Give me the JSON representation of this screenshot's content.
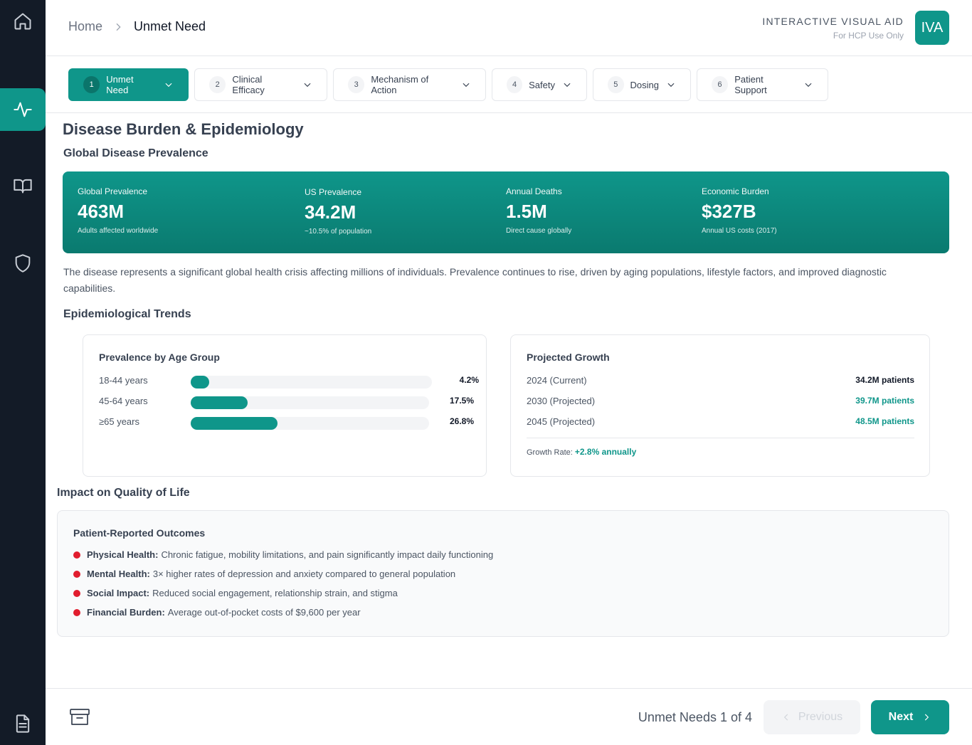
{
  "sidebar": {
    "icons": [
      "home-icon",
      "activity-icon",
      "book-icon",
      "shield-icon",
      "document-icon"
    ],
    "active": "activity-icon"
  },
  "header": {
    "breadcrumb_home": "Home",
    "breadcrumb_current": "Unmet Need",
    "brand_title": "INTERACTIVE VISUAL AID",
    "brand_subtitle": "For HCP Use Only",
    "logo_text": "IVA"
  },
  "tabs": [
    {
      "num": "1",
      "label": "Unmet Need",
      "active": true
    },
    {
      "num": "2",
      "label": "Clinical Efficacy",
      "active": false
    },
    {
      "num": "3",
      "label": "Mechanism of Action",
      "active": false
    },
    {
      "num": "4",
      "label": "Safety",
      "active": false
    },
    {
      "num": "5",
      "label": "Dosing",
      "active": false
    },
    {
      "num": "6",
      "label": "Patient Support",
      "active": false
    }
  ],
  "main": {
    "title": "Disease Burden & Epidemiology",
    "prevalence_heading": "Global Disease Prevalence",
    "stats": [
      {
        "label": "Global Prevalence",
        "value": "463M",
        "sub": "Adults affected worldwide"
      },
      {
        "label": "US Prevalence",
        "value": "34.2M",
        "sub": "~10.5% of population"
      },
      {
        "label": "Annual Deaths",
        "value": "1.5M",
        "sub": "Direct cause globally"
      },
      {
        "label": "Economic Burden",
        "value": "$327B",
        "sub": "Annual US costs (2017)"
      }
    ],
    "description": "The disease represents a significant global health crisis affecting millions of individuals. Prevalence continues to rise, driven by aging populations, lifestyle factors, and improved diagnostic capabilities.",
    "trends_heading": "Epidemiological Trends",
    "age_card": {
      "title": "Prevalence by Age Group",
      "rows": [
        {
          "label": "18-44 years",
          "value": "4.2%",
          "fraction": 0.042
        },
        {
          "label": "45-64 years",
          "value": "17.5%",
          "fraction": 0.175
        },
        {
          "label": "≥65 years",
          "value": "26.8%",
          "fraction": 0.268
        }
      ]
    },
    "growth_card": {
      "title": "Projected Growth",
      "rows": [
        {
          "label": "2024 (Current)",
          "value": "34.2M patients"
        },
        {
          "label": "2030 (Projected)",
          "value": "39.7M patients"
        },
        {
          "label": "2045 (Projected)",
          "value": "48.5M patients"
        }
      ],
      "rate_label": "Growth Rate:",
      "rate_value": "+2.8% annually"
    },
    "qol_heading": "Impact on Quality of Life",
    "qol_card": {
      "title": "Patient-Reported Outcomes",
      "items": [
        {
          "label": "Physical Health:",
          "text": "Chronic fatigue, mobility limitations, and pain significantly impact daily functioning"
        },
        {
          "label": "Mental Health:",
          "text": "3× higher rates of depression and anxiety compared to general population"
        },
        {
          "label": "Social Impact:",
          "text": "Reduced social engagement, relationship strain, and stigma"
        },
        {
          "label": "Financial Burden:",
          "text": "Average out-of-pocket costs of $9,600 per year"
        }
      ]
    }
  },
  "footer": {
    "page_indicator": "Unmet Needs 1 of 4",
    "previous_label": "Previous",
    "next_label": "Next"
  },
  "colors": {
    "accent": "#0f968a",
    "sidebar": "#131b27",
    "bullet": "#e11d2e"
  }
}
